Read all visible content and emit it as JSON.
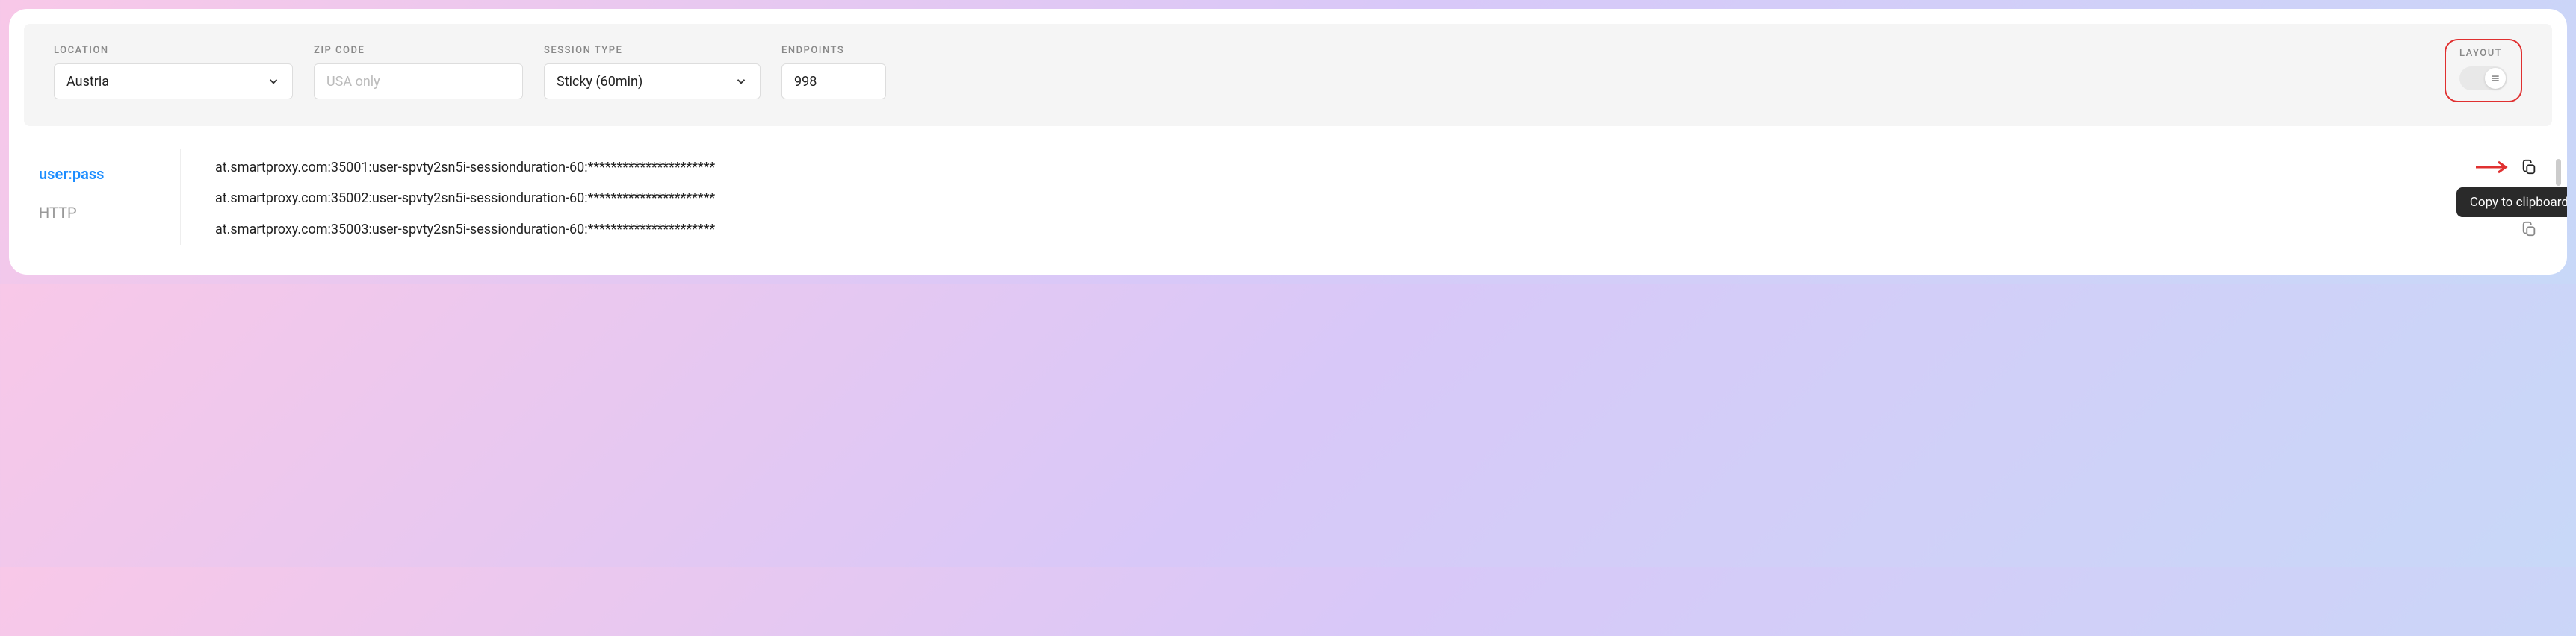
{
  "filters": {
    "location": {
      "label": "LOCATION",
      "value": "Austria"
    },
    "zip": {
      "label": "ZIP CODE",
      "placeholder": "USA only"
    },
    "session": {
      "label": "SESSION TYPE",
      "value": "Sticky (60min)"
    },
    "endpoints": {
      "label": "ENDPOINTS",
      "value": "998"
    },
    "layout": {
      "label": "LAYOUT"
    }
  },
  "tabs": {
    "userpass": "user:pass",
    "http": "HTTP"
  },
  "endpoint_rows": [
    "at.smartproxy.com:35001:user-spvty2sn5i-sessionduration-60:**********************",
    "at.smartproxy.com:35002:user-spvty2sn5i-sessionduration-60:**********************",
    "at.smartproxy.com:35003:user-spvty2sn5i-sessionduration-60:**********************"
  ],
  "tooltip": "Copy to clipboard"
}
